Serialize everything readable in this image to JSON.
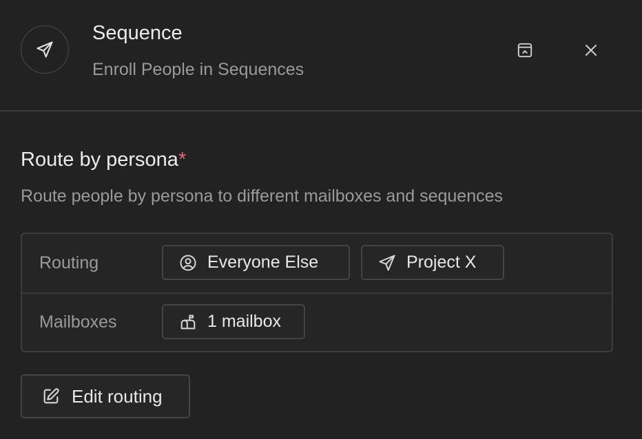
{
  "header": {
    "title": "Sequence",
    "subtitle": "Enroll People in Sequences",
    "icon": "send-icon",
    "actions": [
      {
        "name": "collapse-panel",
        "icon": "panel-collapse-icon"
      },
      {
        "name": "close",
        "icon": "close-icon"
      }
    ]
  },
  "section": {
    "title": "Route by persona",
    "required_mark": "*",
    "description": "Route people by persona to different mailboxes and sequences"
  },
  "routing_table": {
    "rows": [
      {
        "label": "Routing",
        "chips": [
          {
            "icon": "user-circle-icon",
            "label": "Everyone Else"
          },
          {
            "icon": "send-icon",
            "label": "Project X"
          }
        ]
      },
      {
        "label": "Mailboxes",
        "chips": [
          {
            "icon": "mailbox-icon",
            "label": "1 mailbox"
          }
        ]
      }
    ]
  },
  "edit_button": {
    "icon": "edit-icon",
    "label": "Edit routing"
  },
  "colors": {
    "background": "#222222",
    "required_mark": "#e06c75",
    "muted_text": "#9a9a9a"
  }
}
